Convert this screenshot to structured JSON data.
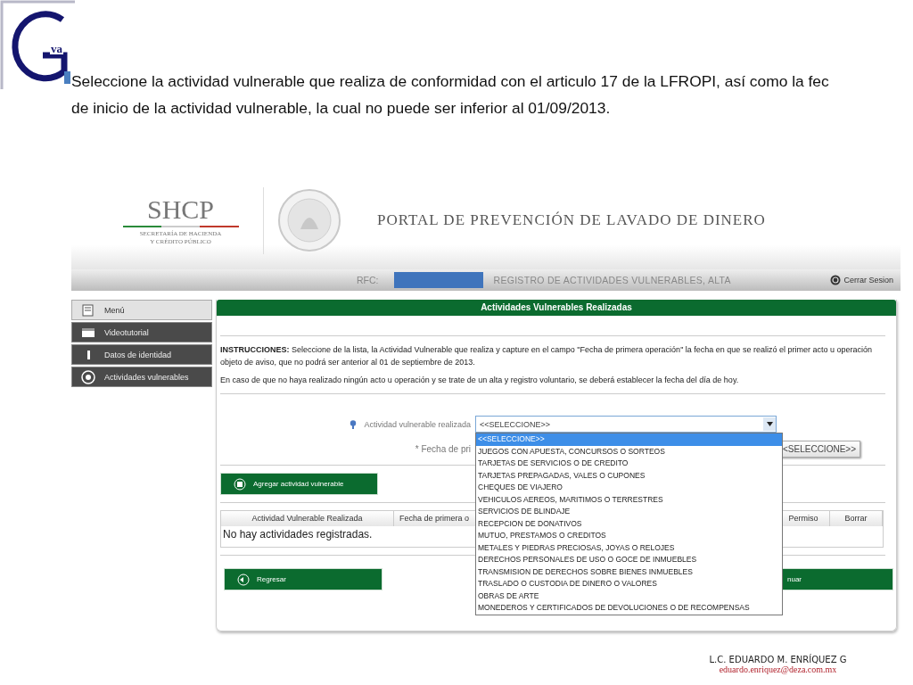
{
  "slide": {
    "logo_text": "va",
    "heading": [
      "Seleccione la actividad vulnerable que realiza de conformidad con el articulo 17 de la LFROPI, así como la fec",
      "de inicio de la actividad vulnerable, la cual no puede ser inferior al 01/09/2013."
    ]
  },
  "portal": {
    "agency": "SHCP",
    "agency_name": [
      "SECRETARÍA DE HACIENDA",
      "Y CRÉDITO PÚBLICO"
    ],
    "title": "PORTAL DE PREVENCIÓN DE LAVADO DE DINERO"
  },
  "top_bar": {
    "rfc_label": "RFC:",
    "section": "REGISTRO DE ACTIVIDADES VULNERABLES, ALTA",
    "logout": "Cerrar Sesion"
  },
  "sidebar": {
    "items": [
      {
        "label": "Menú",
        "selected": true
      },
      {
        "label": "Videotutorial",
        "selected": false
      },
      {
        "label": "Datos de identidad",
        "selected": false
      },
      {
        "label": "Actividades vulnerables",
        "selected": false
      }
    ]
  },
  "panel": {
    "title": "Actividades Vulnerables Realizadas",
    "instructions": [
      "**INSTRUCCIONES:** Seleccione de la lista, la Actividad Vulnerable que realiza y capture en el campo \"Fecha de primera operación\" la fecha en que se realizó el primer acto u operación objeto de aviso, que no podrá ser anterior al 01 de septiembre de 2013.",
      "En caso de que no haya realizado ningún acto u operación y se trate de un alta y registro voluntario, se deberá establecer la fecha del día de hoy."
    ],
    "activity_field": {
      "label": "Actividad vulnerable realizada",
      "value": "<<SELECCIONE>>",
      "options": [
        {
          "label": "<<SELECCIONE>>",
          "selected": true
        },
        {
          "label": "JUEGOS CON APUESTA, CONCURSOS O SORTEOS",
          "selected": false
        },
        {
          "label": "TARJETAS DE SERVICIOS O DE CREDITO",
          "selected": false
        },
        {
          "label": "TARJETAS PREPAGADAS, VALES O CUPONES",
          "selected": false
        },
        {
          "label": "CHEQUES DE VIAJERO",
          "selected": false
        },
        {
          "label": "VEHICULOS AEREOS, MARITIMOS O TERRESTRES",
          "selected": false
        },
        {
          "label": "SERVICIOS DE BLINDAJE",
          "selected": false
        },
        {
          "label": "RECEPCION DE DONATIVOS",
          "selected": false
        },
        {
          "label": "MUTUO, PRESTAMOS O CREDITOS",
          "selected": false
        },
        {
          "label": "METALES Y PIEDRAS PRECIOSAS, JOYAS O RELOJES",
          "selected": false
        },
        {
          "label": "DERECHOS PERSONALES DE USO O GOCE DE INMUEBLES",
          "selected": false
        },
        {
          "label": "TRANSMISION DE DERECHOS SOBRE BIENES INMUEBLES",
          "selected": false
        },
        {
          "label": "TRASLADO O CUSTODIA DE DINERO O VALORES",
          "selected": false
        },
        {
          "label": "OBRAS DE ARTE",
          "selected": false
        },
        {
          "label": "MONEDEROS Y CERTIFICADOS DE DEVOLUCIONES O DE RECOMPENSAS",
          "selected": false
        }
      ]
    },
    "date_field": {
      "label": "* Fecha de pri",
      "value": "<SELECCIONE>>"
    },
    "add_button": "Agregar actividad vulnerable",
    "table": {
      "columns": [
        "Actividad Vulnerable Realizada",
        "Fecha de primera o",
        "Permiso",
        "Borrar"
      ],
      "empty_message": "No hay actividades registradas."
    },
    "back_button": "Regresar",
    "next_button": "nuar"
  },
  "footer": {
    "author": "L.C. EDUARDO M. ENRÍQUEZ G",
    "email": "eduardo.enriquez@deza.com.mx"
  }
}
